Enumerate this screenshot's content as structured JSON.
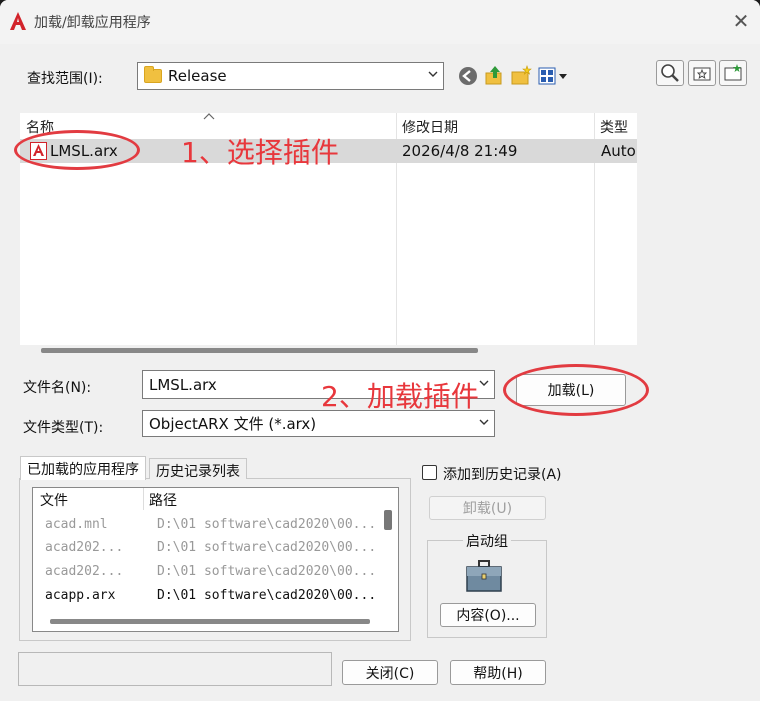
{
  "window": {
    "title": "加载/卸载应用程序",
    "close_glyph": "✕"
  },
  "look_in": {
    "label": "查找范围(I):",
    "value": "Release"
  },
  "file_list": {
    "columns": [
      "名称",
      "修改日期",
      "类型"
    ],
    "rows": [
      {
        "name": "LMSL.arx",
        "date": "2026/4/8 21:49",
        "type": "Auto"
      }
    ]
  },
  "annotations": {
    "step1": "1、选择插件",
    "step2": "2、加载插件"
  },
  "file_name": {
    "label": "文件名(N):",
    "value": "LMSL.arx"
  },
  "file_type": {
    "label": "文件类型(T):",
    "value": "ObjectARX 文件 (*.arx)"
  },
  "buttons": {
    "load": "加载(L)",
    "unload": "卸载(U)",
    "contents": "内容(O)...",
    "close": "关闭(C)",
    "help": "帮助(H)"
  },
  "tabs": {
    "loaded": "已加载的应用程序",
    "history": "历史记录列表"
  },
  "loaded_apps": {
    "columns": [
      "文件",
      "路径"
    ],
    "rows": [
      {
        "file": "acad.mnl",
        "path": "D:\\01 software\\cad2020\\00..."
      },
      {
        "file": "acad202...",
        "path": "D:\\01 software\\cad2020\\00..."
      },
      {
        "file": "acad202...",
        "path": "D:\\01 software\\cad2020\\00..."
      },
      {
        "file": "acapp.arx",
        "path": "D:\\01 software\\cad2020\\00..."
      }
    ]
  },
  "history_checkbox": {
    "label": "添加到历史记录(A)",
    "checked": false
  },
  "startup_group": {
    "label": "启动组",
    "icon": "briefcase-icon"
  },
  "colors": {
    "annotation_red": "#e23b41",
    "selected_row": "#d9d9d9"
  }
}
